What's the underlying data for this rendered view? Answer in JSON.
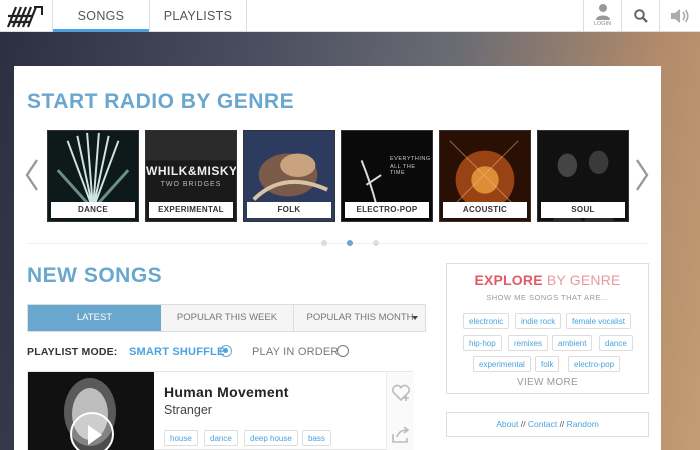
{
  "nav": {
    "tabs": [
      {
        "label": "SONGS",
        "active": true
      },
      {
        "label": "PLAYLISTS",
        "active": false
      }
    ],
    "login_label": "LOGIN",
    "accent": "#4aa3df"
  },
  "genre_radio": {
    "title": "START RADIO BY GENRE",
    "genres": [
      {
        "label": "DANCE",
        "colors": [
          "#0e1a1a",
          "#6c8f86"
        ]
      },
      {
        "label": "EXPERIMENTAL",
        "colors": [
          "#1a1a1a",
          "#555"
        ],
        "art_text": [
          "WHILK&MISKY",
          "TWO BRIDGES"
        ]
      },
      {
        "label": "FOLK",
        "colors": [
          "#2d3b5e",
          "#7a5b4a"
        ]
      },
      {
        "label": "ELECTRO-POP",
        "colors": [
          "#0a0a0a",
          "#2a2a2a"
        ],
        "art_text": [
          "EVERYTHING",
          "ALL THE TIME"
        ]
      },
      {
        "label": "ACOUSTIC",
        "colors": [
          "#2a0f05",
          "#c85a1a"
        ]
      },
      {
        "label": "SOUL",
        "colors": [
          "#111",
          "#333"
        ]
      }
    ],
    "pager_active": 2
  },
  "new_songs": {
    "title": "NEW SONGS",
    "tabs": [
      "LATEST",
      "POPULAR THIS WEEK",
      "POPULAR THIS MONTH"
    ],
    "active_tab": 0,
    "playlist_mode_label": "PLAYLIST MODE:",
    "mode_options": [
      {
        "label": "SMART SHUFFLE",
        "selected": true
      },
      {
        "label": "PLAY IN ORDER",
        "selected": false
      }
    ],
    "songs": [
      {
        "title": "Human Movement",
        "artist": "Stranger",
        "tags": [
          "house",
          "dance",
          "deep house",
          "bass"
        ]
      }
    ]
  },
  "explore": {
    "title_highlight": "EXPLORE",
    "title_rest": " BY GENRE",
    "subtitle": "SHOW ME SONGS THAT ARE...",
    "tags": [
      "electronic",
      "indie rock",
      "female vocalist",
      "hip-hop",
      "remixes",
      "ambient",
      "dance",
      "experimental",
      "folk",
      "electro-pop"
    ],
    "more_label": "VIEW MORE"
  },
  "footer_links": {
    "about": "About",
    "contact": "Contact",
    "random": "Random",
    "separator": "//"
  }
}
